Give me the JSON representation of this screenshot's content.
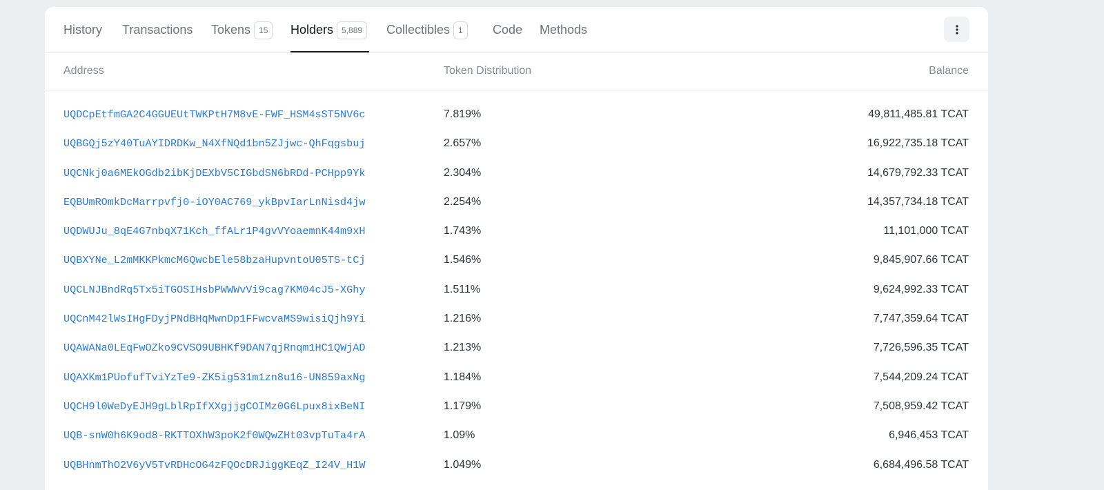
{
  "tabs": [
    {
      "label": "History",
      "badge": null
    },
    {
      "label": "Transactions",
      "badge": null
    },
    {
      "label": "Tokens",
      "badge": "15"
    },
    {
      "label": "Holders",
      "badge": "5,889",
      "active": true
    },
    {
      "label": "Collectibles",
      "badge": "1"
    },
    {
      "label": "Code",
      "badge": null
    },
    {
      "label": "Methods",
      "badge": null
    }
  ],
  "table": {
    "headers": {
      "address": "Address",
      "distribution": "Token Distribution",
      "balance": "Balance"
    },
    "rows": [
      {
        "address": "UQDCpEtfmGA2C4GGUEUtTWKPtH7M8vE-FWF_HSM4sST5NV6c",
        "distribution": "7.819%",
        "balance": "49,811,485.81 TCAT"
      },
      {
        "address": "UQBGQj5zY40TuAYIDRDKw_N4XfNQd1bn5ZJjwc-QhFqgsbuj",
        "distribution": "2.657%",
        "balance": "16,922,735.18 TCAT"
      },
      {
        "address": "UQCNkj0a6MEkOGdb2ibKjDEXbV5CIGbdSN6bRDd-PCHpp9Yk",
        "distribution": "2.304%",
        "balance": "14,679,792.33 TCAT"
      },
      {
        "address": "EQBUmROmkDcMarrpvfj0-iOY0AC769_ykBpvIarLnNisd4jw",
        "distribution": "2.254%",
        "balance": "14,357,734.18 TCAT"
      },
      {
        "address": "UQDWUJu_8qE4G7nbqX71Kch_ffALr1P4gvVYoaemnK44m9xH",
        "distribution": "1.743%",
        "balance": "11,101,000 TCAT"
      },
      {
        "address": "UQBXYNe_L2mMKKPkmcM6QwcbEle58bzaHupvntoU05TS-tCj",
        "distribution": "1.546%",
        "balance": "9,845,907.66 TCAT"
      },
      {
        "address": "UQCLNJBndRq5Tx5iTGOSIHsbPWWWvVi9cag7KM04cJ5-XGhy",
        "distribution": "1.511%",
        "balance": "9,624,992.33 TCAT"
      },
      {
        "address": "UQCnM42lWsIHgFDyjPNdBHqMwnDp1FFwcvaMS9wisiQjh9Yi",
        "distribution": "1.216%",
        "balance": "7,747,359.64 TCAT"
      },
      {
        "address": "UQAWANa0LEqFwOZko9CVSO9UBHKf9DAN7qjRnqm1HC1QWjAD",
        "distribution": "1.213%",
        "balance": "7,726,596.35 TCAT"
      },
      {
        "address": "UQAXKm1PUofufTviYzTe9-ZK5ig531m1zn8u16-UN859axNg",
        "distribution": "1.184%",
        "balance": "7,544,209.24 TCAT"
      },
      {
        "address": "UQCH9l0WeDyEJH9gLblRpIfXXgjjgCOIMz0G6Lpux8ixBeNI",
        "distribution": "1.179%",
        "balance": "7,508,959.42 TCAT"
      },
      {
        "address": "UQB-snW0h6K9od8-RKTTOXhW3poK2f0WQwZHt03vpTuTa4rA",
        "distribution": "1.09%",
        "balance": "6,946,453 TCAT"
      },
      {
        "address": "UQBHnmThO2V6yV5TvRDHcOG4zFQOcDRJiggKEqZ_I24V_H1W",
        "distribution": "1.049%",
        "balance": "6,684,496.58 TCAT"
      }
    ]
  },
  "menu_icon": "more-vertical-icon",
  "colors": {
    "link": "#2c7bd4",
    "active_tab": "#16181c",
    "background": "#eceef0"
  }
}
